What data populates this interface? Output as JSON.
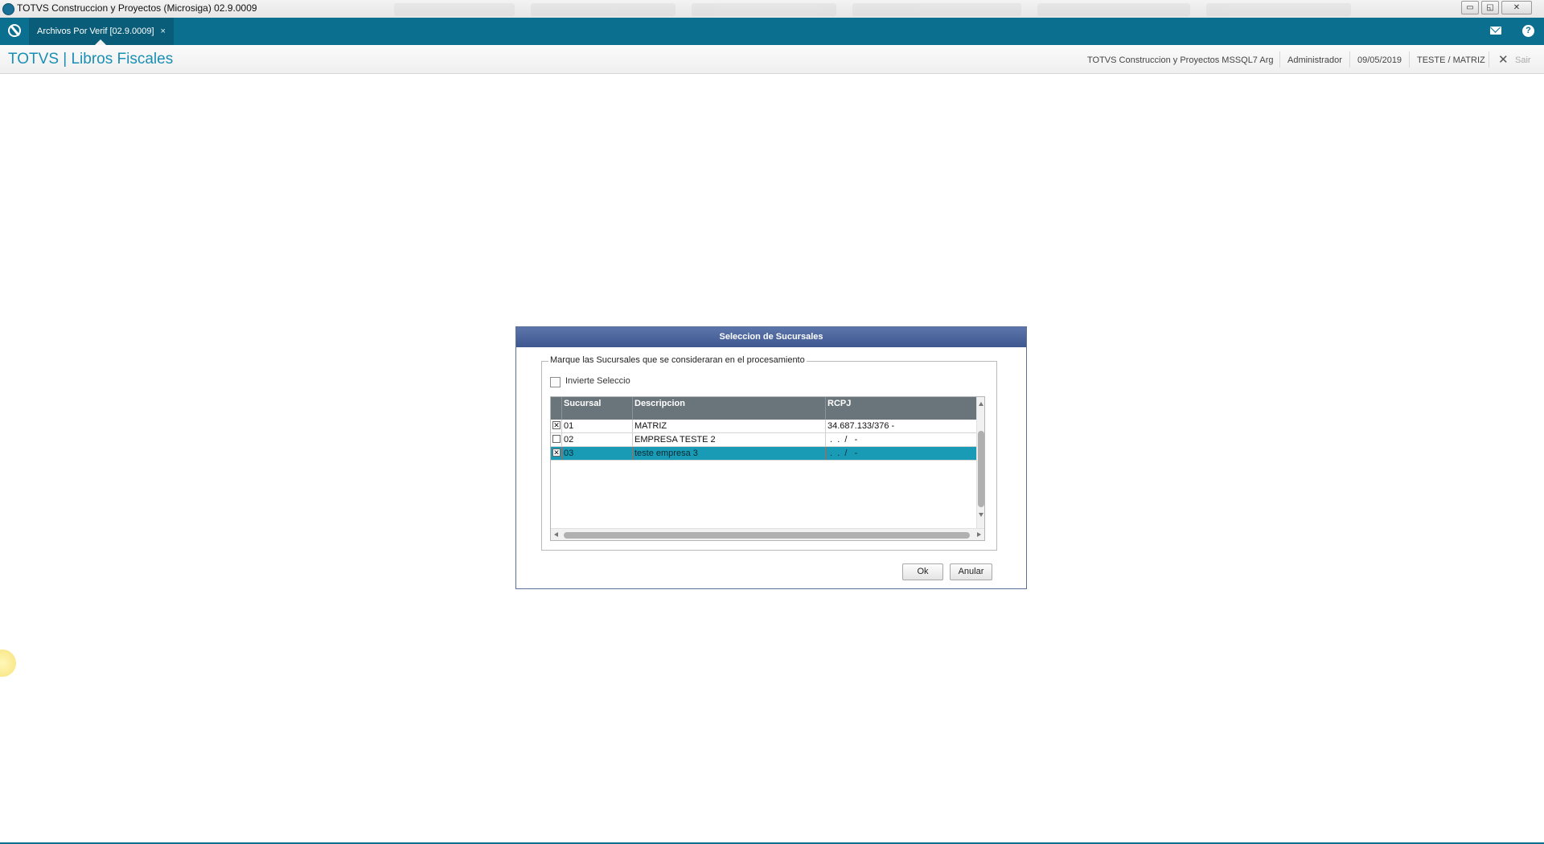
{
  "window": {
    "title": "TOTVS Construccion y Proyectos (Microsiga) 02.9.0009",
    "controls": {
      "minimize": "▭",
      "restore": "◱",
      "close": "✕"
    }
  },
  "tabbar": {
    "active_tab": "Archivos Por Verif [02.9.0009]",
    "close_glyph": "×",
    "help_glyph": "?"
  },
  "header": {
    "app_title": "TOTVS | Libros Fiscales",
    "company": "TOTVS Construccion y Proyectos MSSQL7 Arg",
    "user": "Administrador",
    "date": "09/05/2019",
    "branch": "TESTE / MATRIZ",
    "exit_glyph": "✕",
    "exit_label": "Sair"
  },
  "dialog": {
    "title": "Seleccion de Sucursales",
    "group_label": "Marque las Sucursales que se consideraran en el procesamiento",
    "invert_label": "Invierte Seleccio",
    "invert_checked": false,
    "columns": [
      "Sucursal",
      "Descripcion",
      "RCPJ"
    ],
    "rows": [
      {
        "checked": true,
        "check_glyph": "✕",
        "sucursal": "01",
        "descripcion": "MATRIZ",
        "rcpj": "34.687.133/376 -"
      },
      {
        "checked": false,
        "check_glyph": "",
        "sucursal": "02",
        "descripcion": "EMPRESA TESTE 2",
        "rcpj": " .  .  /   -"
      },
      {
        "checked": true,
        "check_glyph": "✕",
        "sucursal": "03",
        "descripcion": "teste empresa 3",
        "rcpj": " .  .  /   -"
      }
    ],
    "selected_row": 2,
    "ok_label": "Ok",
    "cancel_label": "Anular"
  },
  "colors": {
    "tabbar": "#0b6f8f",
    "title_accent": "#1a8fb4",
    "dialog_title": "#4a629a",
    "selected_row": "#1a9bb5",
    "grid_header": "#6a747b"
  }
}
